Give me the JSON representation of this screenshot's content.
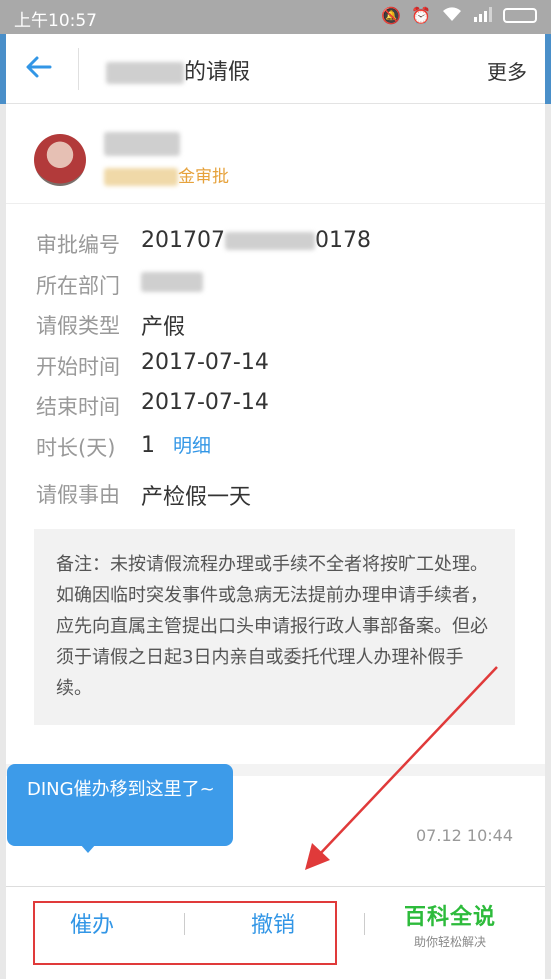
{
  "status_bar": {
    "time": "上午10:57"
  },
  "navbar": {
    "title_suffix": "的请假",
    "more_label": "更多"
  },
  "profile": {
    "status_suffix": "金审批"
  },
  "fields": [
    {
      "label": "审批编号",
      "value": "201707",
      "value_tail": "0178"
    },
    {
      "label": "所在部门",
      "value": ""
    },
    {
      "label": "请假类型",
      "value": "产假"
    },
    {
      "label": "开始时间",
      "value": "2017-07-14"
    },
    {
      "label": "结束时间",
      "value": "2017-07-14"
    },
    {
      "label": "时长(天)",
      "value": "1",
      "link": "明细"
    },
    {
      "label": "请假事由",
      "value": "产检假一天"
    }
  ],
  "note": "备注：未按请假流程办理或手续不全者将按旷工处理。如确因临时突发事件或急病无法提前办理申请手续者，应先向直属主管提出口头申请报行政人事部备案。但必须于请假之日起3日内亲自或委托代理人办理补假手续。",
  "flow": {
    "timestamp": "07.12 10:44"
  },
  "tooltip": {
    "text": "DING催办移到这里了~"
  },
  "bottom_bar": {
    "urge_label": "催办",
    "revoke_label": "撤销"
  },
  "watermark": {
    "title": "百科全说",
    "subtitle": "助你轻松解决"
  },
  "colors": {
    "accent": "#3296e6",
    "highlight": "#e03a3a",
    "status": "#e6a23c",
    "brand": "#2dbb3b"
  },
  "icons": {
    "back": "arrow-left-icon",
    "mute": "mute-icon",
    "alarm": "alarm-icon",
    "wifi": "wifi-icon",
    "signal": "signal-icon",
    "battery": "battery-icon"
  }
}
